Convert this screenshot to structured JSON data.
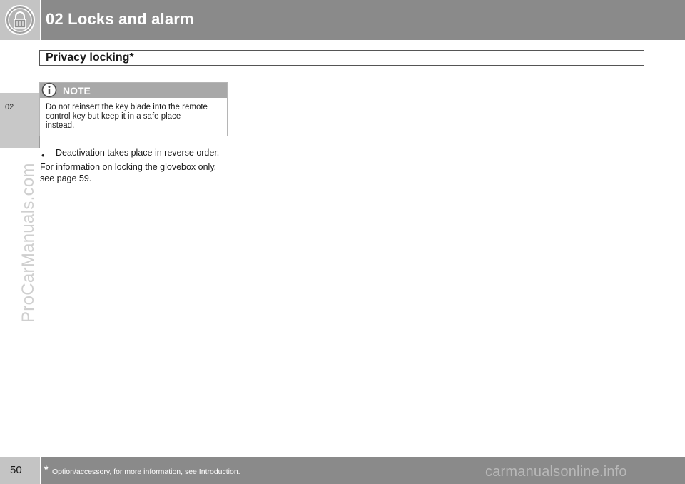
{
  "header": {
    "chapter_title": "02 Locks and alarm",
    "icon": "lock-icon"
  },
  "side_tab": {
    "label": "02"
  },
  "section": {
    "title": "Privacy locking*"
  },
  "note": {
    "icon": "info-icon",
    "title": "NOTE",
    "lines": [
      "Do not reinsert the key blade into the remote",
      "control key but keep it in a safe place",
      "instead."
    ]
  },
  "body": {
    "bullet": "•",
    "bullet_text": "Deactivation takes place in reverse order.",
    "paragraph_lines": [
      "For information on locking the glovebox only,",
      "see page 59."
    ]
  },
  "watermarks": {
    "side": "ProCarManuals.com",
    "footer": "carmanualsonline.info"
  },
  "footer": {
    "page_number": "50",
    "star": "*",
    "footnote": "Option/accessory, for more information, see Introduction."
  },
  "colors": {
    "header_bar": "#8a8a8a",
    "header_left": "#c4c4c4",
    "note_header": "#a8a8a8"
  }
}
